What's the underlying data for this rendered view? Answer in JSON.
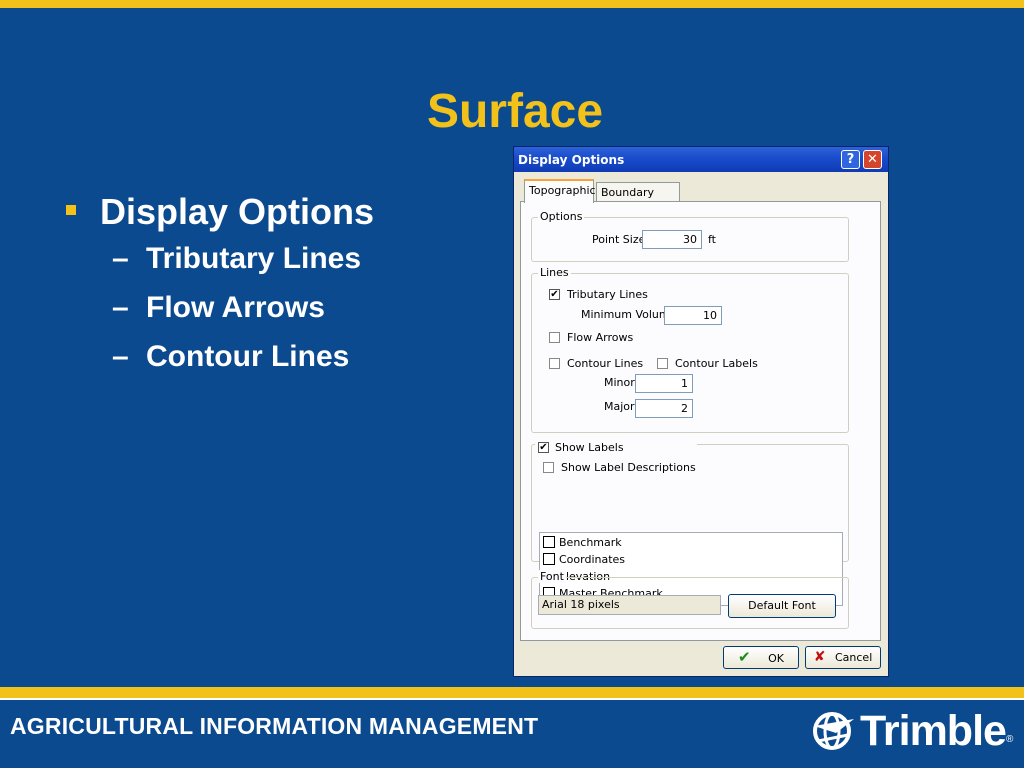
{
  "slide": {
    "title": "Surface",
    "bullet_main": "Display Options",
    "sub_bullets": [
      "Tributary Lines",
      "Flow Arrows",
      "Contour Lines"
    ],
    "dash": "–",
    "footer": "AGRICULTURAL INFORMATION MANAGEMENT",
    "logo": "Trimble",
    "logo_reg": "®"
  },
  "dialog": {
    "title": "Display Options",
    "help_btn": "?",
    "close_btn": "✕",
    "tabs": [
      "Topographic",
      "Boundary Layer"
    ],
    "options_group": "Options",
    "point_size_label": "Point Size",
    "point_size_value": "30",
    "point_size_unit": "ft",
    "lines_group": "Lines",
    "tributary_lines": "Tributary Lines",
    "tributary_checked": "✔",
    "minimum_volume_label": "Minimum Volume",
    "minimum_volume_value": "10",
    "flow_arrows": "Flow Arrows",
    "contour_lines": "Contour Lines",
    "contour_labels": "Contour Labels",
    "minor_label": "Minor",
    "minor_value": "1",
    "major_label": "Major",
    "major_value": "2",
    "show_labels": "Show Labels",
    "show_labels_checked": "✔",
    "show_label_descriptions": "Show Label Descriptions",
    "label_items": [
      "Benchmark",
      "Coordinates",
      "Elevation",
      "Master Benchmark"
    ],
    "font_group": "Font",
    "font_value": "Arial 18 pixels",
    "default_font_btn": "Default Font",
    "ok_icon": "✔",
    "ok_btn": "OK",
    "cancel_icon": "✘",
    "cancel_btn": "Cancel"
  },
  "colors": {
    "background": "#0b4a8f",
    "gold": "#f2c21b"
  }
}
